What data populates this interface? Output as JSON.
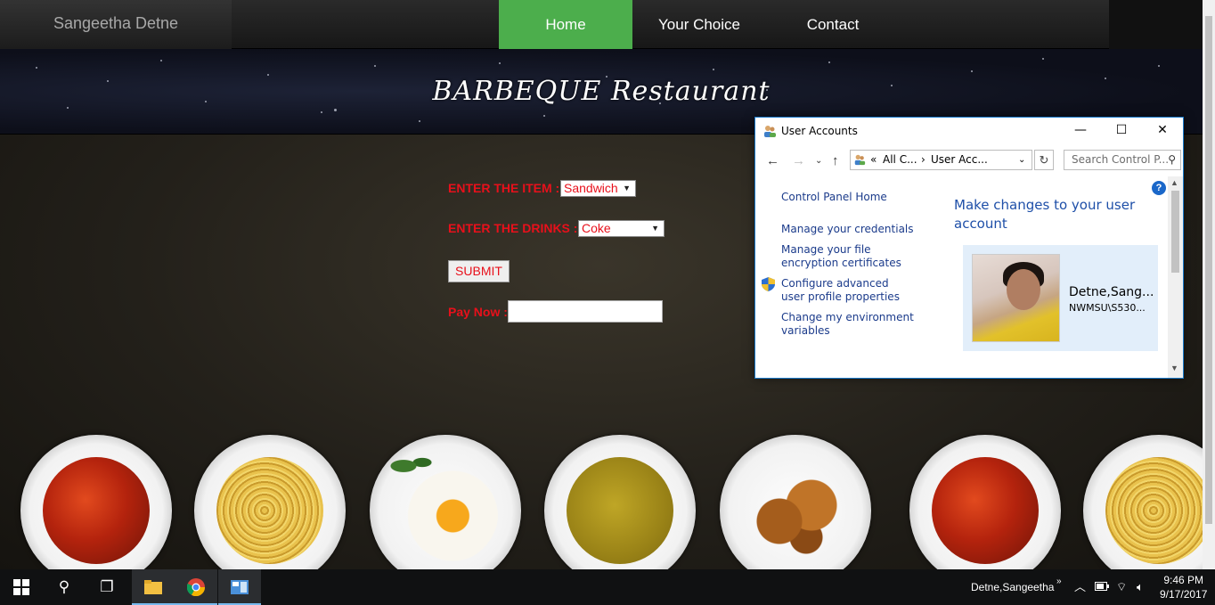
{
  "nav": {
    "brand": "Sangeetha Detne",
    "items": [
      {
        "label": "Home",
        "active": true
      },
      {
        "label": "Your Choice",
        "active": false
      },
      {
        "label": "Contact",
        "active": false
      }
    ]
  },
  "banner": {
    "title": "BARBEQUE Restaurant"
  },
  "form": {
    "item_label": "ENTER THE ITEM :",
    "item_value": "Sandwich",
    "drinks_label": "ENTER THE DRINKS :",
    "drinks_value": "Coke",
    "submit_label": "SUBMIT",
    "pay_label": "Pay Now :",
    "pay_value": ""
  },
  "window": {
    "title": "User Accounts",
    "breadcrumb": [
      "All C...",
      "User Acc..."
    ],
    "breadcrumb_prefix": "«",
    "search_placeholder": "Search Control P...",
    "links": [
      "Control Panel Home",
      "Manage your credentials",
      "Manage your file encryption certificates",
      "Configure advanced user profile properties",
      "Change my environment variables"
    ],
    "heading": "Make changes to your user account",
    "user_name": "Detne,Sang...",
    "user_domain": "NWMSU\\S530..."
  },
  "taskbar": {
    "user": "Detne,Sangeetha",
    "time": "9:46 PM",
    "date": "9/17/2017"
  },
  "colors": {
    "accent_green": "#4cae4c",
    "form_red": "#e8101b",
    "link_blue": "#1b3b8b",
    "heading_blue": "#1e4fa8"
  }
}
